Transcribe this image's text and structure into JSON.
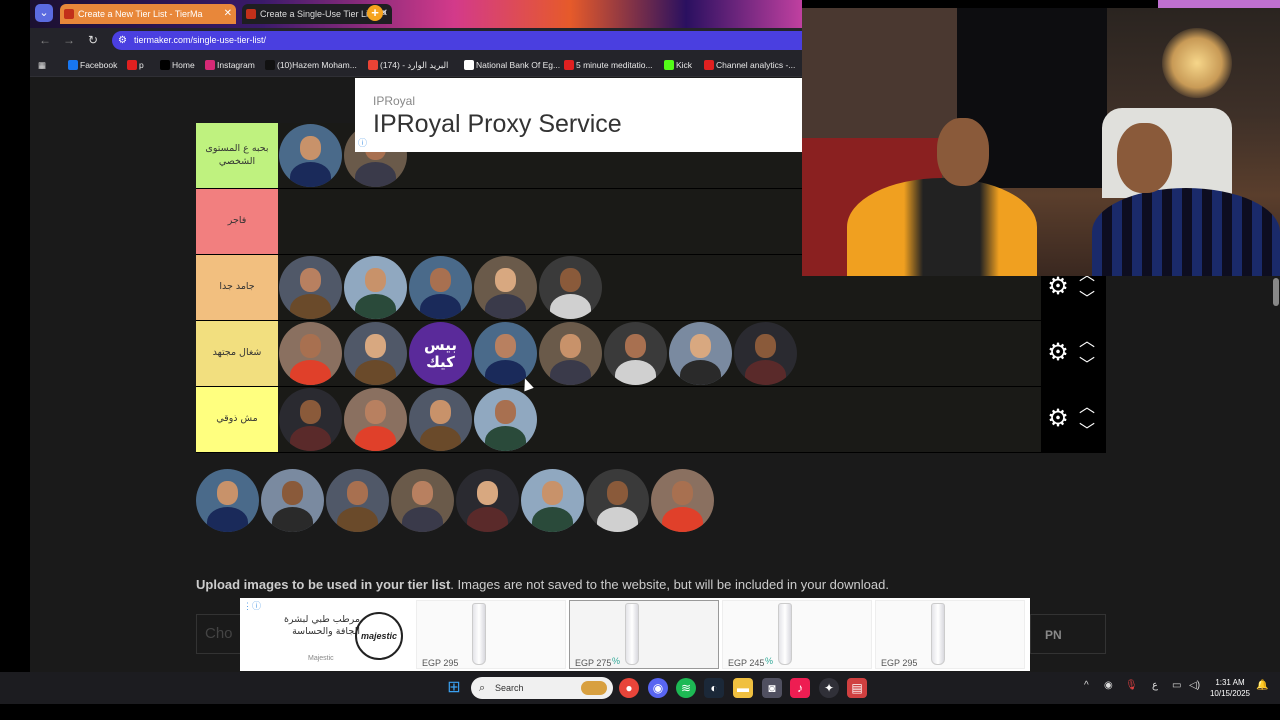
{
  "browser": {
    "tabs": [
      {
        "title": "Create a New Tier List - TierMa",
        "active": true
      },
      {
        "title": "Create a Single-Use Tier List (P",
        "active": false
      }
    ],
    "url": "tiermaker.com/single-use-tier-list/",
    "bookmarks": [
      {
        "label": "Facebook",
        "color": "#1877f2"
      },
      {
        "label": "p",
        "color": "#e02020"
      },
      {
        "label": "Home",
        "color": "#000000"
      },
      {
        "label": "Instagram",
        "color": "#d62976"
      },
      {
        "label": "(10)Hazem Moham...",
        "color": "#111111"
      },
      {
        "label": "(174) - البريد الوارد",
        "color": "#ea4335"
      },
      {
        "label": "National Bank Of Eg...",
        "color": "#ffffff"
      },
      {
        "label": "5 minute meditatio...",
        "color": "#e02020"
      },
      {
        "label": "Kick",
        "color": "#53fc18"
      },
      {
        "label": "Channel analytics -...",
        "color": "#e02020"
      }
    ]
  },
  "ads": {
    "top": {
      "brand": "IPRoyal",
      "headline": "IPRoyal Proxy Service"
    },
    "bottom": {
      "tagline": "مرطب طبي لبشرة الجافة والحساسة",
      "logo": "majestic",
      "sub": "Majestic",
      "products": [
        {
          "price": "EGP 295",
          "discount": ""
        },
        {
          "price": "EGP 275",
          "discount": "%"
        },
        {
          "price": "EGP 245",
          "discount": "%"
        },
        {
          "price": "EGP 295",
          "discount": ""
        }
      ]
    }
  },
  "tiers": [
    {
      "label": "بحبه ع المستوى الشخصي",
      "color": "#bff27f",
      "count": 2
    },
    {
      "label": "فاجر",
      "color": "#f27f7f",
      "count": 0
    },
    {
      "label": "جامد جدا",
      "color": "#f2bf7f",
      "count": 5
    },
    {
      "label": "شغال مجتهد",
      "color": "#f2df7f",
      "count": 8
    },
    {
      "label": "مش ذوقي",
      "color": "#ffff7f",
      "count": 4
    }
  ],
  "featured_avatar_text": "بيس كيك",
  "pool_count": 8,
  "upload": {
    "bold": "Upload images to be used in your tier list",
    "rest": ". Images are not saved to the website, but will be included in your download."
  },
  "faded": {
    "input": "Cho",
    "button": "PN"
  },
  "taskbar": {
    "search_placeholder": "Search",
    "lang": "ع",
    "time": "1:31 AM",
    "date": "10/15/2025"
  },
  "icons": {
    "menu": "chevron-down-icon",
    "gear": "gear-icon",
    "up": "chevron-up-icon",
    "down": "chevron-down-icon"
  }
}
